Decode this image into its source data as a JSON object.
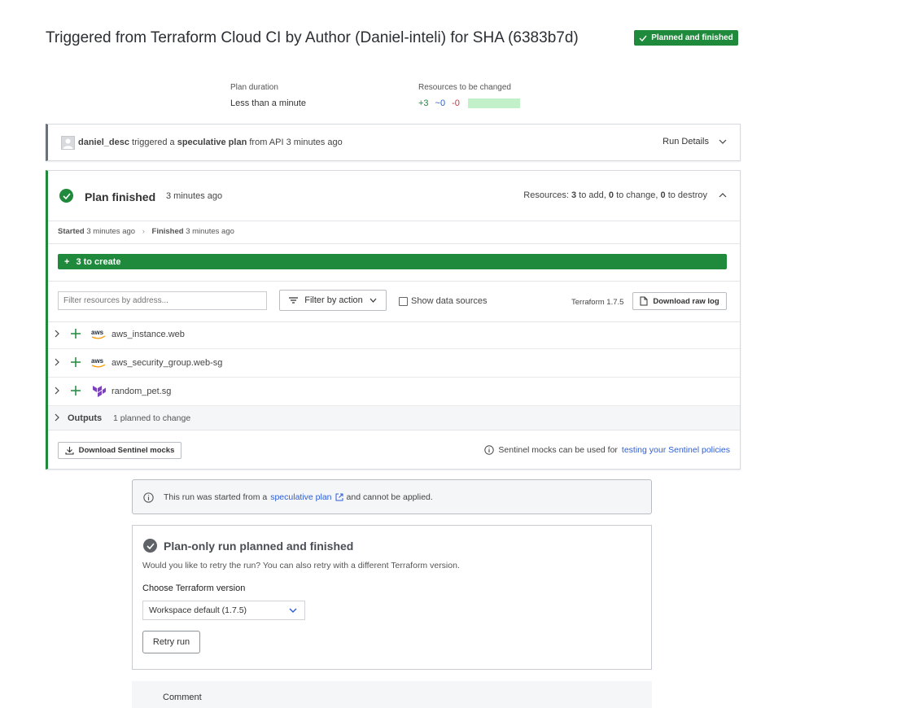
{
  "header": {
    "title": "Triggered from Terraform Cloud CI by Author (Daniel-inteli) for SHA (6383b7d)",
    "status_badge": "Planned and finished",
    "status_color": "#1f8a3b"
  },
  "summary": {
    "plan_duration_label": "Plan duration",
    "plan_duration_value": "Less than a minute",
    "resources_label": "Resources to be changed",
    "adds": "+3",
    "changes": "~0",
    "destroys": "-0"
  },
  "trigger": {
    "user": "daniel_desc",
    "text1": "triggered a",
    "plan_type": "speculative plan",
    "text2": "from API 3 minutes ago",
    "run_details": "Run Details"
  },
  "plan": {
    "title": "Plan finished",
    "time": "3 minutes ago",
    "resources_prefix": "Resources:",
    "add_count": "3",
    "add_text": "to add,",
    "change_count": "0",
    "change_text": "to change,",
    "destroy_count": "0",
    "destroy_text": "to destroy",
    "started_label": "Started",
    "started_time": "3 minutes ago",
    "finished_label": "Finished",
    "finished_time": "3 minutes ago",
    "create_bar": "3 to create",
    "filter_placeholder": "Filter resources by address...",
    "filter_action": "Filter by action",
    "show_data_sources": "Show data sources",
    "terraform_version": "Terraform 1.7.5",
    "download_raw_log": "Download raw log",
    "resources": [
      {
        "name": "aws_instance.web",
        "provider": "aws"
      },
      {
        "name": "aws_security_group.web-sg",
        "provider": "aws"
      },
      {
        "name": "random_pet.sg",
        "provider": "terraform"
      }
    ],
    "outputs_label": "Outputs",
    "outputs_desc": "1 planned to change",
    "download_sentinel": "Download Sentinel mocks",
    "sentinel_note": "Sentinel mocks can be used for",
    "sentinel_link": "testing your Sentinel policies"
  },
  "speculative_notice": {
    "text1": "This run was started from a",
    "link": "speculative plan",
    "text2": "and cannot be applied."
  },
  "retry": {
    "title": "Plan-only run planned and finished",
    "desc": "Would you like to retry the run? You can also retry with a different Terraform version.",
    "choose_label": "Choose Terraform version",
    "version_value": "Workspace default (1.7.5)",
    "retry_button": "Retry run"
  },
  "comment": {
    "label": "Comment"
  }
}
